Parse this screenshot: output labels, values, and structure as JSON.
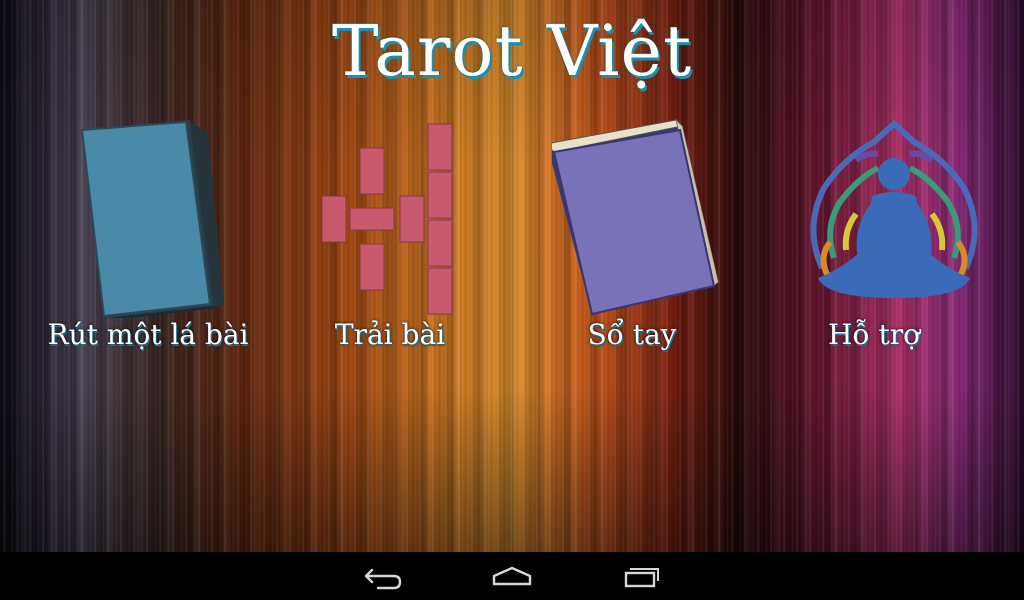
{
  "app": {
    "title": "Tarot Việt"
  },
  "menu": [
    {
      "label": "Rút một lá bài",
      "icon": "card-deck-icon"
    },
    {
      "label": "Trải bài",
      "icon": "card-spread-icon"
    },
    {
      "label": "Sổ tay",
      "icon": "book-icon"
    },
    {
      "label": "Hỗ trợ",
      "icon": "meditation-icon"
    }
  ],
  "navbar": {
    "buttons": [
      "back-icon",
      "home-icon",
      "recent-apps-icon"
    ]
  },
  "colors": {
    "card": "#4a8aa8",
    "spread": "#c85a6e",
    "book": "#7a72b8",
    "figure": "#3a6ab8"
  }
}
